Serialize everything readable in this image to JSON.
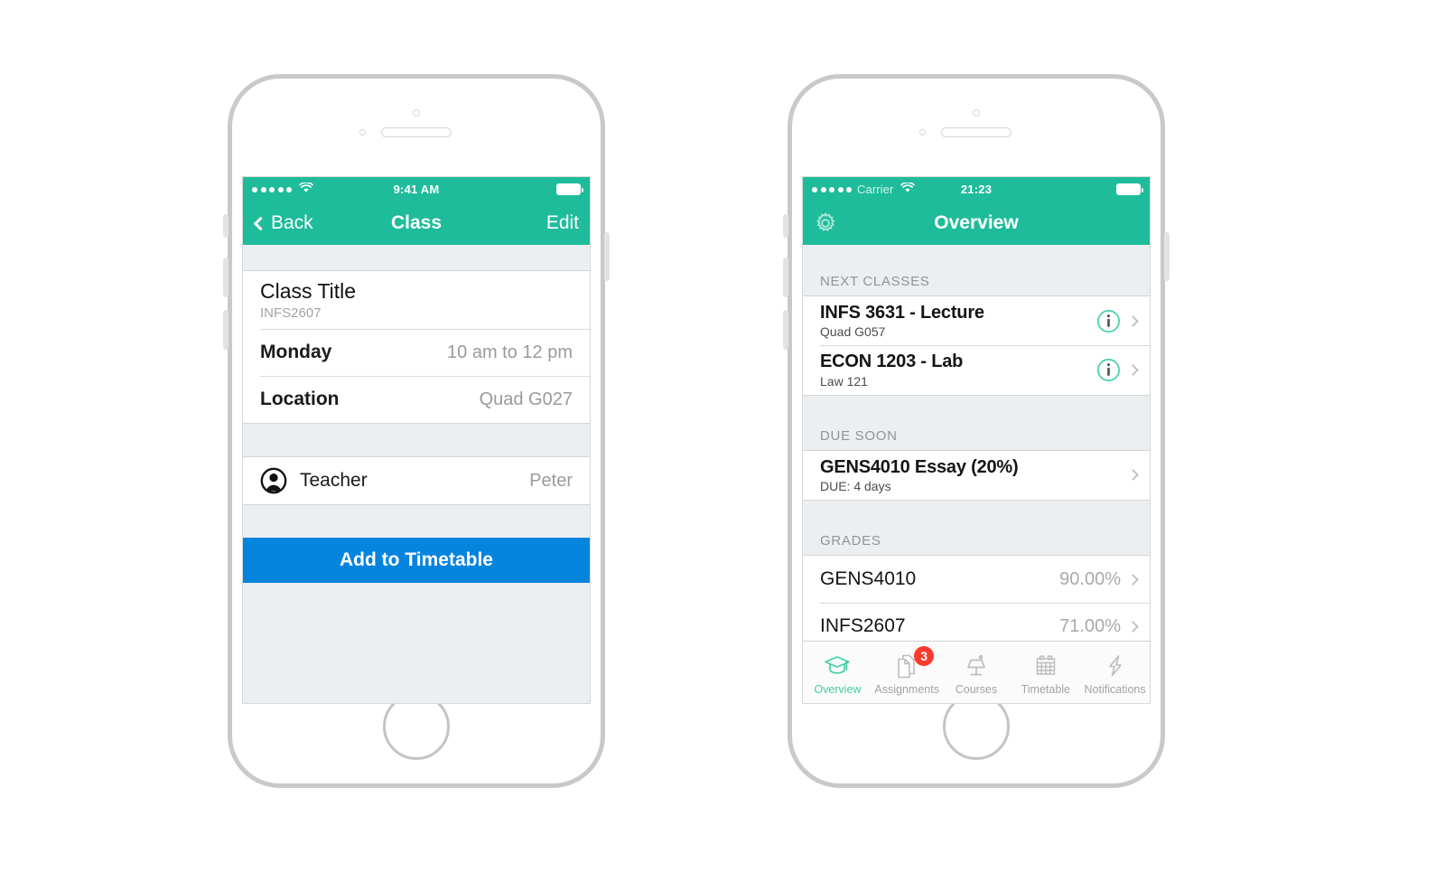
{
  "left_phone": {
    "status_bar": {
      "signal_dots": 5,
      "wifi_icon": "wifi-icon",
      "time": "9:41 AM",
      "battery_icon": "battery-full-icon"
    },
    "nav": {
      "back_label": "Back",
      "back_icon": "chevron-left-icon",
      "title": "Class",
      "edit_label": "Edit"
    },
    "detail_rows": [
      {
        "label": "Class Title",
        "sub": "INFS2607",
        "value": ""
      },
      {
        "label": "Monday",
        "value": "10 am to 12 pm"
      },
      {
        "label": "Location",
        "value": "Quad G027"
      }
    ],
    "teacher_row": {
      "icon": "person-avatar-icon",
      "label": "Teacher",
      "value": "Peter"
    },
    "cta_label": "Add to Timetable"
  },
  "right_phone": {
    "status_bar": {
      "signal_dots": 5,
      "carrier": "Carrier",
      "wifi_icon": "wifi-icon",
      "time": "21:23",
      "battery_icon": "battery-full-icon"
    },
    "nav": {
      "settings_icon": "gear-icon",
      "title": "Overview"
    },
    "sections": [
      {
        "header": "NEXT CLASSES",
        "rows": [
          {
            "title": "INFS 3631 - Lecture",
            "sub": "Quad G057",
            "info_icon": "info-circle-icon",
            "chevron": "chevron-right-icon"
          },
          {
            "title": "ECON 1203 - Lab",
            "sub": "Law 121",
            "info_icon": "info-circle-icon",
            "chevron": "chevron-right-icon"
          }
        ]
      },
      {
        "header": "DUE SOON",
        "rows": [
          {
            "title": "GENS4010 Essay (20%)",
            "sub": "DUE: 4 days",
            "chevron": "chevron-right-icon"
          }
        ]
      },
      {
        "header": "GRADES",
        "rows": [
          {
            "title": "GENS4010",
            "value": "90.00%",
            "chevron": "chevron-right-icon"
          },
          {
            "title": "INFS2607",
            "value": "71.00%",
            "chevron": "chevron-right-icon"
          }
        ]
      }
    ],
    "tabs": [
      {
        "label": "Overview",
        "icon": "graduation-cap-icon",
        "active": true,
        "badge": ""
      },
      {
        "label": "Assignments",
        "icon": "documents-icon",
        "active": false,
        "badge": "3"
      },
      {
        "label": "Courses",
        "icon": "lectern-icon",
        "active": false,
        "badge": ""
      },
      {
        "label": "Timetable",
        "icon": "calendar-icon",
        "active": false,
        "badge": ""
      },
      {
        "label": "Notifications",
        "icon": "lightning-bolt-icon",
        "active": false,
        "badge": ""
      }
    ]
  },
  "colors": {
    "brand_green": "#1ebc9b",
    "accent_blue": "#0584de",
    "badge_red": "#fa3c2d",
    "tab_active": "#3fd0a8",
    "screen_bg": "#eceff1"
  }
}
